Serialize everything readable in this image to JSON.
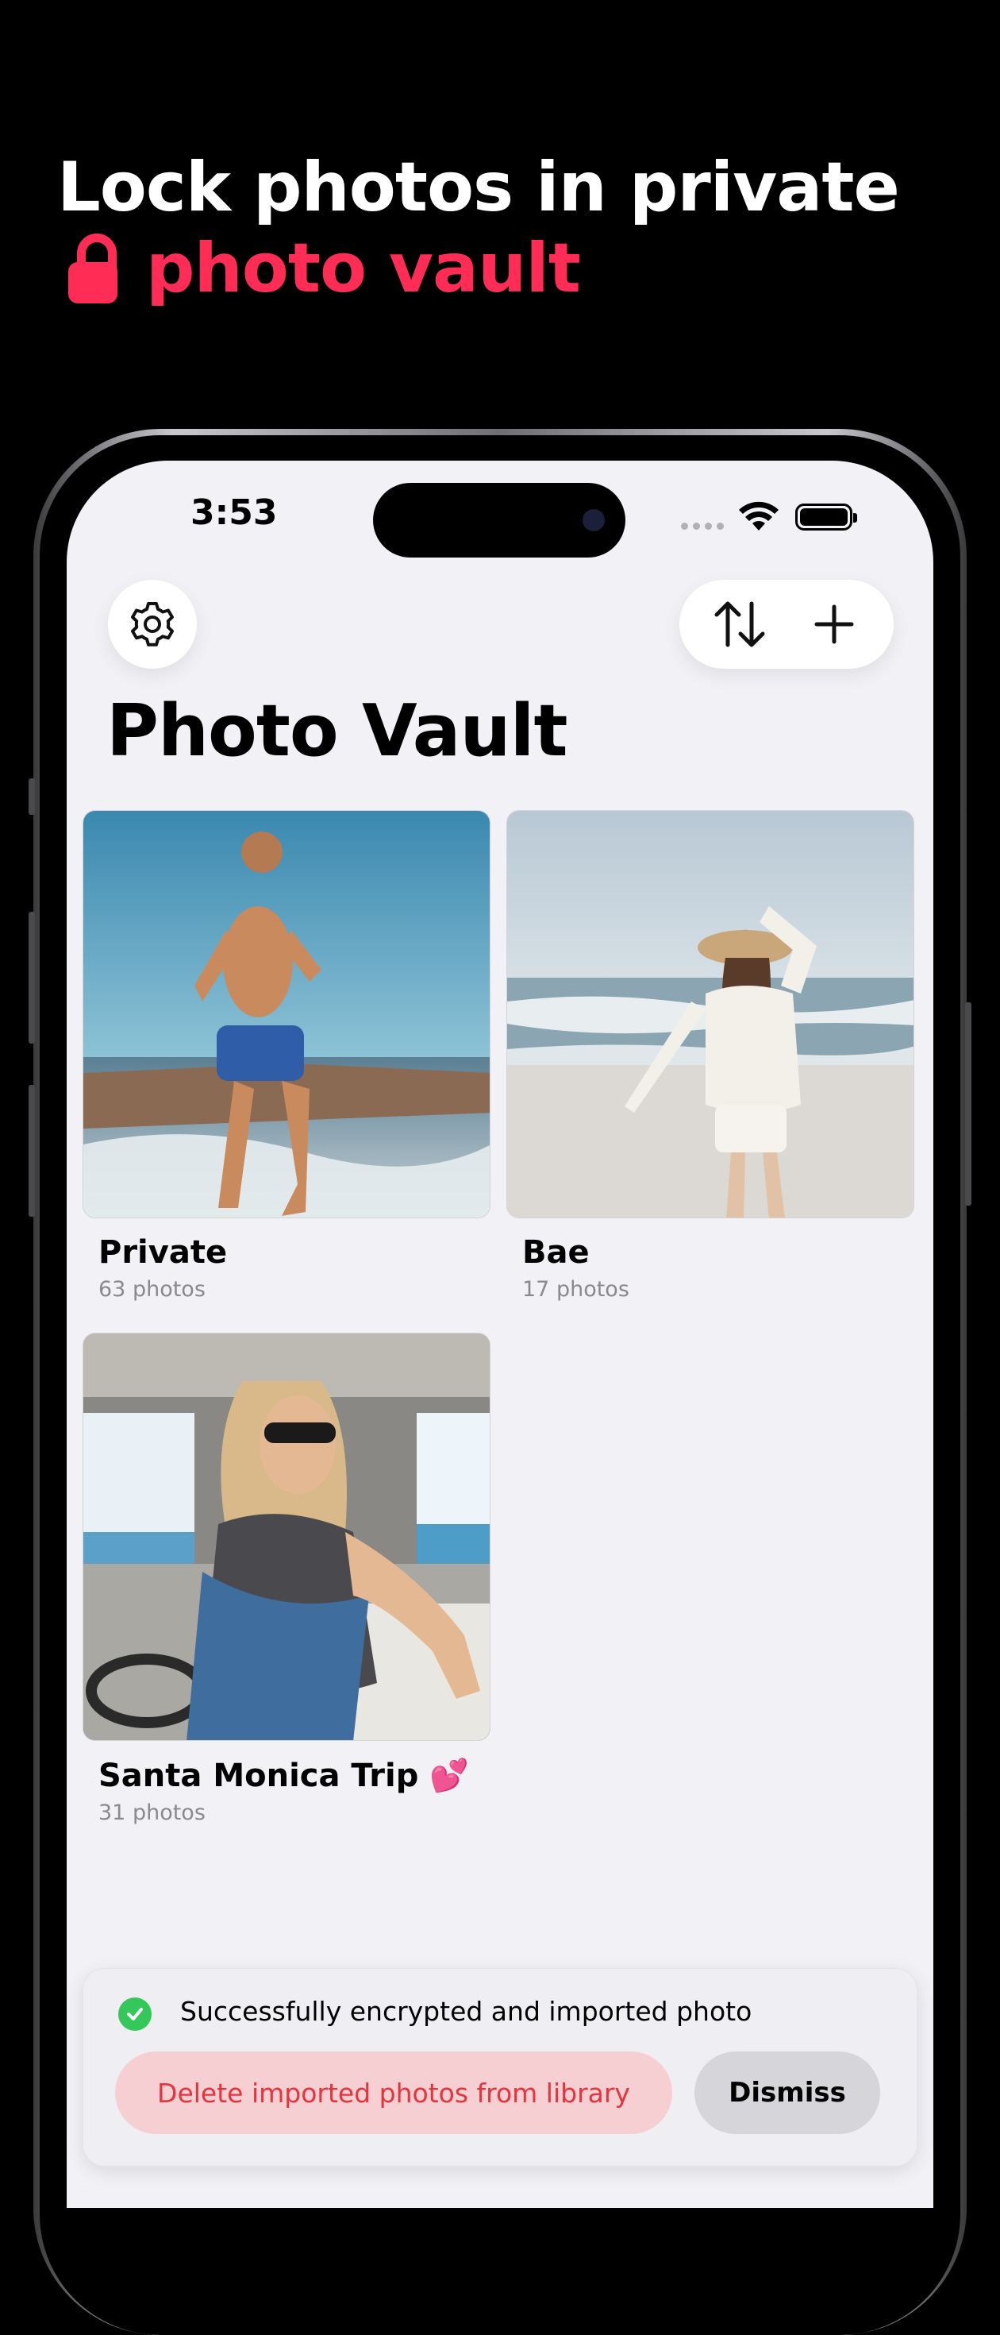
{
  "promo": {
    "headline_line1": "Lock photos in private",
    "headline_line2": "photo vault",
    "accent_color": "#ff2d55"
  },
  "status_bar": {
    "time": "3:53",
    "icons": [
      "cellular-dots-icon",
      "wifi-icon",
      "battery-icon"
    ]
  },
  "toolbar": {
    "settings_icon": "gear-icon",
    "sort_icon": "sort-arrows-icon",
    "add_icon": "plus-icon"
  },
  "page": {
    "title": "Photo Vault"
  },
  "albums": [
    {
      "name": "Private",
      "count": "63 photos"
    },
    {
      "name": "Bae",
      "count": "17 photos"
    },
    {
      "name": "Santa Monica Trip 💕",
      "count": "31 photos"
    }
  ],
  "toast": {
    "message": "Successfully encrypted and imported photo",
    "delete_label": "Delete imported photos from library",
    "dismiss_label": "Dismiss",
    "success_color": "#34c759"
  }
}
